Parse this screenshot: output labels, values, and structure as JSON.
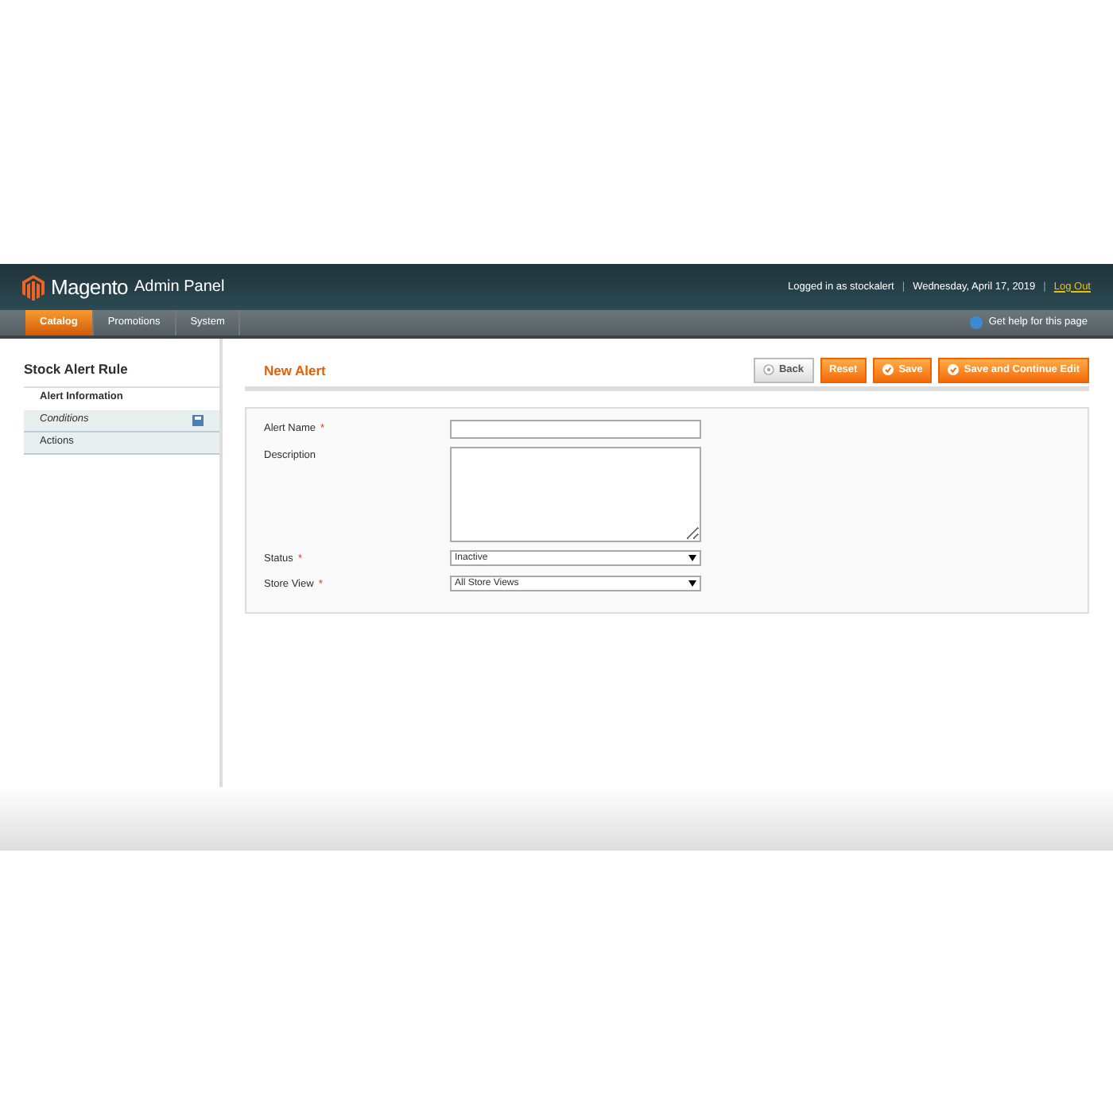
{
  "header": {
    "logo": "Magento",
    "logo_suffix": "Admin Panel",
    "login": "Logged in as stockalert",
    "date": "Wednesday, April 17, 2019",
    "logout": "Log Out",
    "separators": [
      "|",
      "|"
    ]
  },
  "nav": {
    "items": [
      {
        "label": "Catalog",
        "selected": true
      },
      {
        "label": "Promotions",
        "selected": false
      },
      {
        "label": "System",
        "selected": false
      }
    ],
    "help": "Get help for this page"
  },
  "sidebar": {
    "title": "Stock Alert Rule",
    "tabs": [
      {
        "label": "Alert Information",
        "selected": true,
        "italic": false,
        "changed": false
      },
      {
        "label": "Conditions",
        "selected": false,
        "italic": true,
        "changed": true
      },
      {
        "label": "Actions",
        "selected": false,
        "italic": false,
        "changed": false
      }
    ]
  },
  "page_title": "New Alert",
  "buttons": [
    {
      "label": "Back",
      "kind": "back"
    },
    {
      "label": "Reset",
      "kind": "plain"
    },
    {
      "label": "Save",
      "kind": "save"
    },
    {
      "label": "Save and Continue Edit",
      "kind": "save"
    }
  ],
  "form": [
    {
      "label": "Alert Name",
      "mark": "*",
      "kind": "text"
    },
    {
      "label": "Description",
      "kind": "textarea"
    },
    {
      "label": "Status",
      "mark": "*",
      "kind": "select",
      "value": "Inactive"
    },
    {
      "label": "Store View",
      "mark": "*",
      "kind": "select",
      "value": "All Store Views"
    }
  ]
}
